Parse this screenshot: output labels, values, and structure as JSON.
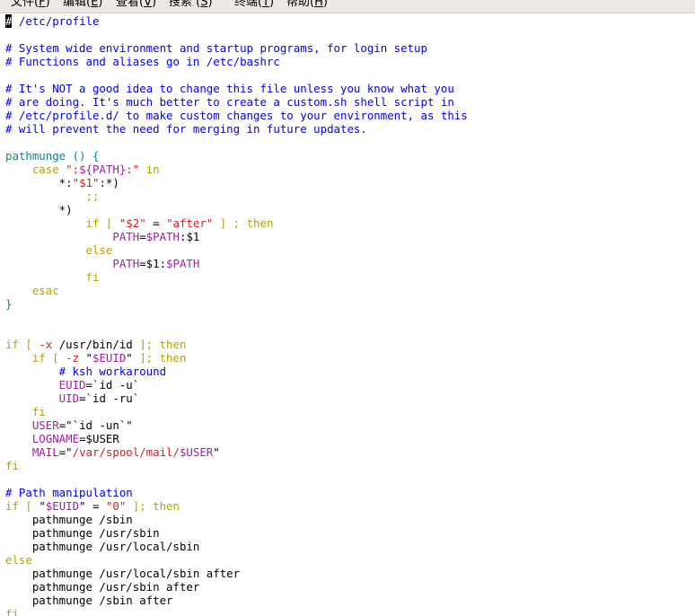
{
  "menu": [
    {
      "text": "文件(",
      "mnemonic": "F",
      "end": ")"
    },
    {
      "text": "编辑(",
      "mnemonic": "E",
      "end": ")"
    },
    {
      "text": "查看(",
      "mnemonic": "V",
      "end": ")"
    },
    {
      "text": "搜索 (",
      "mnemonic": "S",
      "end": ")"
    },
    {
      "text": "终端(",
      "mnemonic": "T",
      "end": ")"
    },
    {
      "text": "帮助(",
      "mnemonic": "H",
      "end": ")"
    }
  ],
  "code_lines": [
    [
      {
        "t": "#",
        "k": "cursor"
      },
      {
        "t": " /etc/profile",
        "k": "comment"
      }
    ],
    [],
    [
      {
        "t": "# System wide environment and startup programs, for login setup",
        "k": "comment"
      }
    ],
    [
      {
        "t": "# Functions and aliases go in /etc/bashrc",
        "k": "comment"
      }
    ],
    [],
    [
      {
        "t": "# It's NOT a good idea to change this file unless you know what you",
        "k": "comment"
      }
    ],
    [
      {
        "t": "# are doing. It's much better to create a custom.sh shell script in",
        "k": "comment"
      }
    ],
    [
      {
        "t": "# /etc/profile.d/ to make custom changes to your environment, as this",
        "k": "comment"
      }
    ],
    [
      {
        "t": "# will prevent the need for merging in future updates.",
        "k": "comment"
      }
    ],
    [],
    [
      {
        "t": "pathmunge () {",
        "k": "func"
      }
    ],
    [
      {
        "t": "    case ",
        "k": "keyword"
      },
      {
        "t": "\":",
        "k": "string"
      },
      {
        "t": "${PATH}",
        "k": "var"
      },
      {
        "t": ":\"",
        "k": "string"
      },
      {
        "t": " in",
        "k": "keyword"
      }
    ],
    [
      {
        "t": "        *:",
        "k": "text"
      },
      {
        "t": "\"$1\"",
        "k": "string"
      },
      {
        "t": ":*)",
        "k": "text"
      }
    ],
    [
      {
        "t": "            ;;",
        "k": "keyword"
      }
    ],
    [
      {
        "t": "        *)",
        "k": "text"
      }
    ],
    [
      {
        "t": "            if [ ",
        "k": "keyword"
      },
      {
        "t": "\"$2\"",
        "k": "string"
      },
      {
        "t": " = ",
        "k": "text"
      },
      {
        "t": "\"after\"",
        "k": "string"
      },
      {
        "t": " ] ; then",
        "k": "keyword"
      }
    ],
    [
      {
        "t": "                ",
        "k": "text"
      },
      {
        "t": "PATH",
        "k": "var"
      },
      {
        "t": "=",
        "k": "text"
      },
      {
        "t": "$PATH",
        "k": "var"
      },
      {
        "t": ":$1",
        "k": "text"
      }
    ],
    [
      {
        "t": "            else",
        "k": "keyword"
      }
    ],
    [
      {
        "t": "                ",
        "k": "text"
      },
      {
        "t": "PATH",
        "k": "var"
      },
      {
        "t": "=$1:",
        "k": "text"
      },
      {
        "t": "$PATH",
        "k": "var"
      }
    ],
    [
      {
        "t": "            fi",
        "k": "keyword"
      }
    ],
    [
      {
        "t": "    esac",
        "k": "keyword"
      }
    ],
    [
      {
        "t": "}",
        "k": "func"
      }
    ],
    [],
    [],
    [
      {
        "t": "if [ ",
        "k": "keyword"
      },
      {
        "t": "-x",
        "k": "string"
      },
      {
        "t": " /usr/bin/id ",
        "k": "text"
      },
      {
        "t": "]; then",
        "k": "keyword"
      }
    ],
    [
      {
        "t": "    if [ ",
        "k": "keyword"
      },
      {
        "t": "-z",
        "k": "string"
      },
      {
        "t": " \"",
        "k": "text"
      },
      {
        "t": "$EUID",
        "k": "var"
      },
      {
        "t": "\" ",
        "k": "text"
      },
      {
        "t": "]; then",
        "k": "keyword"
      }
    ],
    [
      {
        "t": "        # ksh workaround",
        "k": "comment"
      }
    ],
    [
      {
        "t": "        EUID",
        "k": "var"
      },
      {
        "t": "=`id -u`",
        "k": "text"
      }
    ],
    [
      {
        "t": "        UID",
        "k": "var"
      },
      {
        "t": "=`id -ru`",
        "k": "text"
      }
    ],
    [
      {
        "t": "    fi",
        "k": "keyword"
      }
    ],
    [
      {
        "t": "    USER",
        "k": "var"
      },
      {
        "t": "=\"`id -un`\"",
        "k": "text"
      }
    ],
    [
      {
        "t": "    LOGNAME",
        "k": "var"
      },
      {
        "t": "=$USER",
        "k": "text"
      }
    ],
    [
      {
        "t": "    MAIL",
        "k": "var"
      },
      {
        "t": "=\"",
        "k": "text"
      },
      {
        "t": "/var/spool/mail/",
        "k": "string"
      },
      {
        "t": "$USER",
        "k": "var"
      },
      {
        "t": "\"",
        "k": "text"
      }
    ],
    [
      {
        "t": "fi",
        "k": "keyword"
      }
    ],
    [],
    [
      {
        "t": "# Path manipulation",
        "k": "comment"
      }
    ],
    [
      {
        "t": "if [ ",
        "k": "keyword"
      },
      {
        "t": "\"",
        "k": "text"
      },
      {
        "t": "$EUID",
        "k": "var"
      },
      {
        "t": "\" = ",
        "k": "text"
      },
      {
        "t": "\"0\"",
        "k": "string"
      },
      {
        "t": " ]; then",
        "k": "keyword"
      }
    ],
    [
      {
        "t": "    pathmunge /sbin",
        "k": "text"
      }
    ],
    [
      {
        "t": "    pathmunge /usr/sbin",
        "k": "text"
      }
    ],
    [
      {
        "t": "    pathmunge /usr/local/sbin",
        "k": "text"
      }
    ],
    [
      {
        "t": "else",
        "k": "keyword"
      }
    ],
    [
      {
        "t": "    pathmunge /usr/local/sbin after",
        "k": "text"
      }
    ],
    [
      {
        "t": "    pathmunge /usr/sbin after",
        "k": "text"
      }
    ],
    [
      {
        "t": "    pathmunge /sbin after",
        "k": "text"
      }
    ],
    [
      {
        "t": "fi",
        "k": "keyword"
      }
    ]
  ]
}
